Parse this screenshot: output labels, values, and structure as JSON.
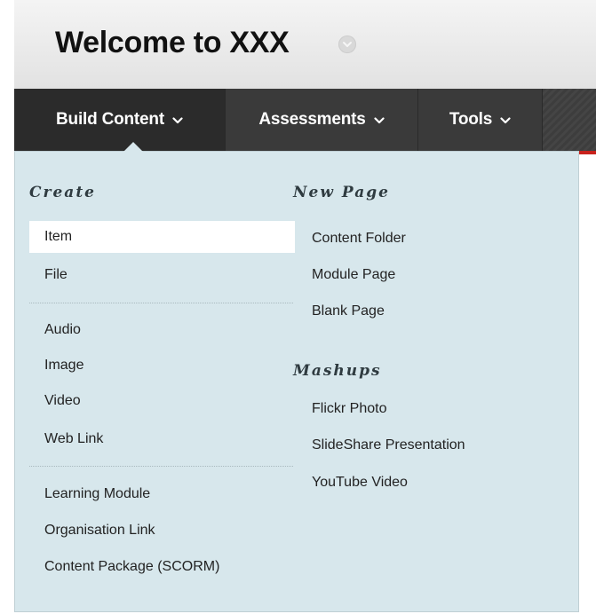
{
  "page": {
    "title": "Welcome to XXX"
  },
  "nav": {
    "tabs": [
      {
        "label": "Build Content"
      },
      {
        "label": "Assessments"
      },
      {
        "label": "Tools"
      }
    ]
  },
  "menu": {
    "create": {
      "heading": "Create",
      "groups": [
        [
          "Item",
          "File"
        ],
        [
          "Audio",
          "Image",
          "Video",
          "Web Link"
        ],
        [
          "Learning Module",
          "Organisation Link",
          "Content Package (SCORM)"
        ]
      ]
    },
    "new_page": {
      "heading": "New Page",
      "items": [
        "Content Folder",
        "Module Page",
        "Blank Page"
      ]
    },
    "mashups": {
      "heading": "Mashups",
      "items": [
        "Flickr Photo",
        "SlideShare Presentation",
        "YouTube Video"
      ]
    },
    "selected_item": "Item"
  },
  "colors": {
    "nav_bg": "#3a3a3a",
    "panel_bg": "#d7e7ec",
    "accent_red": "#c8221c"
  },
  "icons": [
    "chevron-down-icon"
  ]
}
